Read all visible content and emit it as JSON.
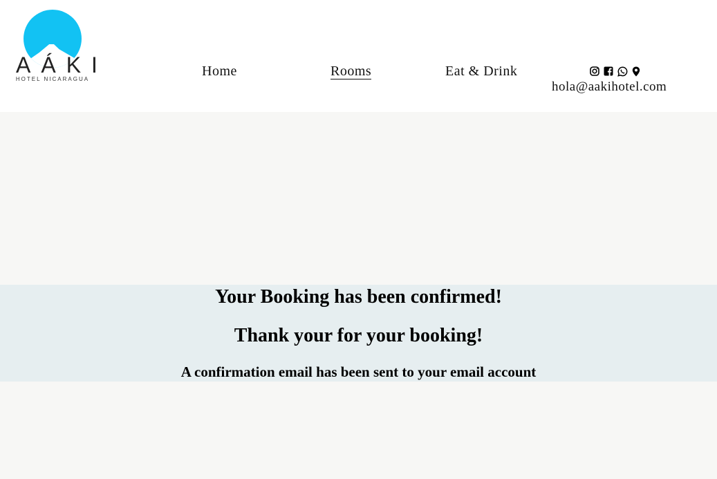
{
  "brand": {
    "name": "AÁKI",
    "subtitle": "HOTEL NICARAGUA",
    "logo_color": "#12c2f3"
  },
  "nav": {
    "items": [
      {
        "label": "Home",
        "active": false
      },
      {
        "label": "Rooms",
        "active": true
      },
      {
        "label": "Eat & Drink",
        "active": false
      }
    ]
  },
  "contact": {
    "icons": [
      "instagram-icon",
      "facebook-icon",
      "whatsapp-icon",
      "map-pin-icon"
    ],
    "email": "hola@aakihotel.com"
  },
  "confirmation": {
    "title": "Your Booking has been confirmed!",
    "thanks": "Thank your for your booking!",
    "note": "A confirmation email has been sent to your email account"
  }
}
